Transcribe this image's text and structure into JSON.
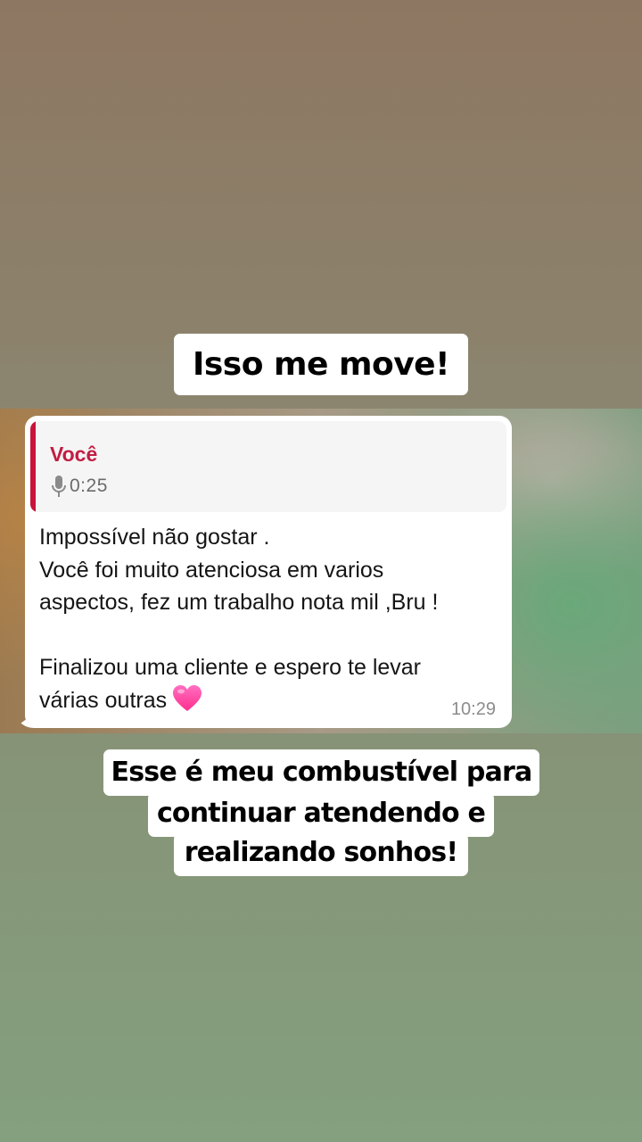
{
  "story": {
    "caption_top": "Isso me move!",
    "caption_bottom_lines": [
      "Esse é meu combustível para",
      "continuar atendendo e",
      "realizando sonhos!"
    ]
  },
  "message": {
    "reply": {
      "author": "Você",
      "audio_duration": "0:25",
      "icon": "microphone-icon"
    },
    "lines": [
      "Impossível não gostar .",
      "Você foi muito atenciosa em varios",
      "aspectos, fez um trabalho nota mil ,Bru !",
      "",
      "Finalizou uma cliente e espero te levar",
      "várias outras"
    ],
    "emoji": "heart-icon",
    "time": "10:29"
  },
  "colors": {
    "reply_accent": "#c8143b",
    "reply_author": "#c21d44",
    "heart": "#ff3fa0"
  }
}
